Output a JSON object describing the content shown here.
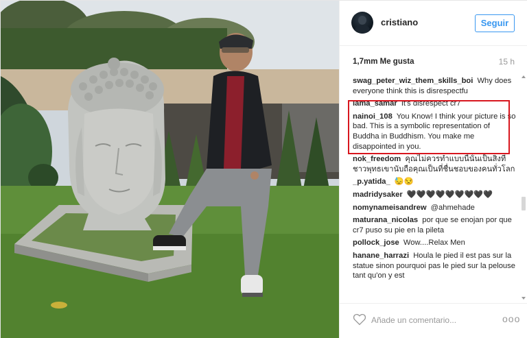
{
  "post": {
    "username": "cristiano",
    "follow_label": "Seguir",
    "likes": "1,7mm Me gusta",
    "time_ago": "15 h"
  },
  "comments": [
    {
      "user": "swag_peter_wiz_them_skills_boi",
      "text": "Why does everyone think this is disrespectfu"
    },
    {
      "user": "lama_samar",
      "text": "It's disrespect cr7"
    },
    {
      "user": "nainoi_108",
      "text": "You Know! I think your picture is so bad. This is a symbolic representation of Buddha in Buddhism. You make me disappointed in you."
    },
    {
      "user": "nok_freedom",
      "text": "คุณไม่ควรทำแบบนี้นั้นเป็นสิ่งที่ชาวพุทธเขานับถือคุณเป็นที่ชื่นชอบของคนทั่วโลก"
    },
    {
      "user": "_p.yatida_",
      "text": "😓😒"
    },
    {
      "user": "madridysaker",
      "text": "🖤🖤🖤🖤🖤🖤🖤🖤🖤"
    },
    {
      "user": "nomynameisandrew",
      "text": "@ahmehade"
    },
    {
      "user": "maturana_nicolas",
      "text": "por que se enojan por que cr7 puso su pie en la pileta"
    },
    {
      "user": "pollock_jose",
      "text": "Wow....Relax Men"
    },
    {
      "user": "hanane_harrazi",
      "text": "Houla le pied il est pas sur la statue sinon pourquoi pas le pied sur la pelouse tant qu'on y est"
    }
  ],
  "footer": {
    "comment_placeholder": "Añade un comentario...",
    "more_label": "ooo"
  },
  "icons": {
    "like": "heart-outline-icon",
    "more": "more-options-icon"
  },
  "colors": {
    "accent": "#3897f0",
    "highlight_border": "#d8161e",
    "text": "#262626",
    "muted": "#999999"
  }
}
